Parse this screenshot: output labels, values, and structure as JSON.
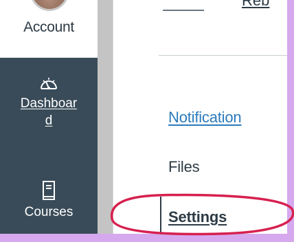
{
  "global_nav": {
    "account_label": "Account",
    "dashboard_label": "Dashboar\nd",
    "dashboard_icon": "dashboard-gauge-icon",
    "courses_label": "Courses",
    "courses_icon": "book-icon",
    "background_color": "#394b58"
  },
  "course_nav": {
    "top_partial_text": "Reb",
    "items": [
      {
        "label": "Notification"
      },
      {
        "label": "Files"
      },
      {
        "label": "Settings"
      }
    ],
    "link_color": "#2b7abc",
    "text_color": "#2d3b45"
  },
  "annotation": {
    "highlight_color": "#d6204f"
  }
}
